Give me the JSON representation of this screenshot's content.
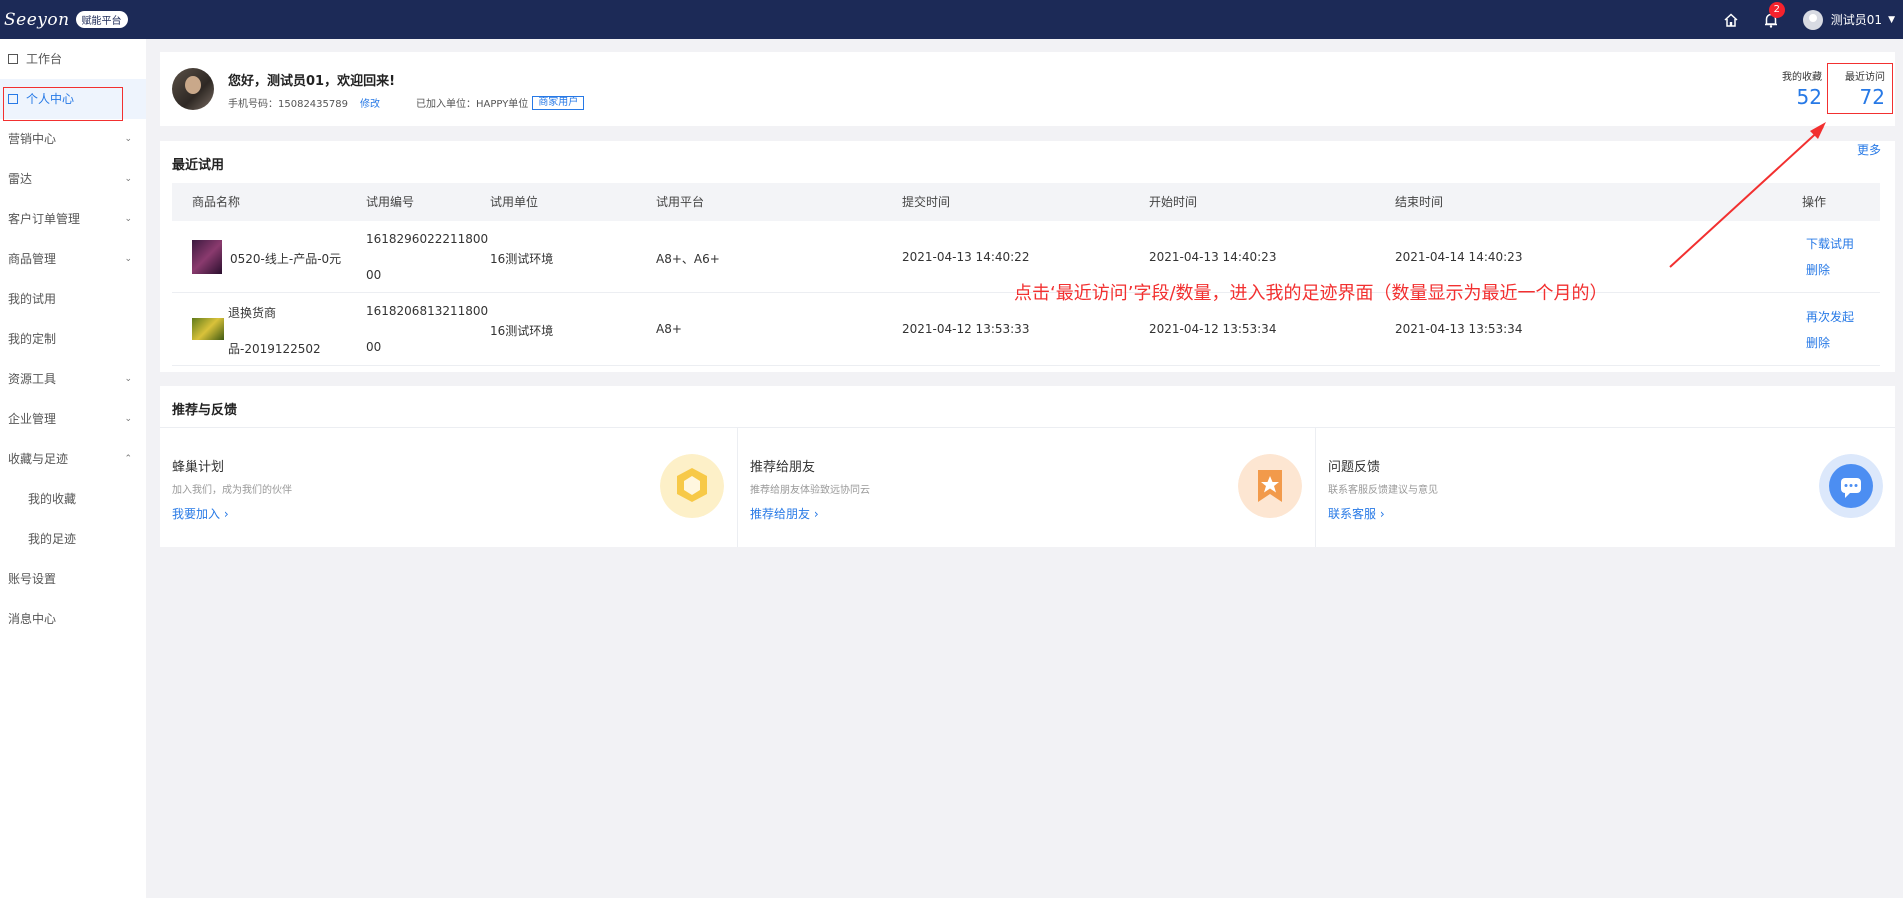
{
  "header": {
    "logo_text": "Seeyon",
    "platform_badge": "赋能平台",
    "notification_count": "2",
    "user_name": "测试员01",
    "icons": [
      "home-icon",
      "bell-icon",
      "avatar",
      "chevron-down-icon"
    ]
  },
  "sidebar": {
    "items": [
      {
        "label": "工作台"
      },
      {
        "label": "个人中心"
      },
      {
        "label": "营销中心"
      },
      {
        "label": "雷达"
      },
      {
        "label": "客户订单管理"
      },
      {
        "label": "商品管理"
      },
      {
        "label": "我的试用"
      },
      {
        "label": "我的定制"
      },
      {
        "label": "资源工具"
      },
      {
        "label": "企业管理"
      },
      {
        "label": "收藏与足迹"
      },
      {
        "label": "我的收藏"
      },
      {
        "label": "我的足迹"
      },
      {
        "label": "账号设置"
      },
      {
        "label": "消息中心"
      }
    ],
    "active_item": "个人中心"
  },
  "profile": {
    "greeting": "您好，测试员01，欢迎回来!",
    "phone_label": "手机号码：15082435789",
    "edit_link": "修改",
    "unit_label": "已加入单位：HAPPY单位",
    "user_type_tag": "商家用户",
    "favorites_label": "我的收藏",
    "favorites_count": "52",
    "recent_label": "最近访问",
    "recent_count": "72"
  },
  "recent_trials": {
    "title": "最近试用",
    "more_link": "更多",
    "columns": [
      "商品名称",
      "试用编号",
      "试用单位",
      "试用平台",
      "提交时间",
      "开始时间",
      "结束时间",
      "操作"
    ],
    "rows": [
      {
        "name_line1": "0520-线上-产品-0元",
        "name_line2": "",
        "id_line1": "1618296022211800",
        "id_line2": "00",
        "unit": "16测试环境",
        "platform": "A8+、A6+",
        "submit_time": "2021-04-13 14:40:22",
        "start_time": "2021-04-13 14:40:23",
        "end_time": "2021-04-14 14:40:23",
        "action1": "下载试用",
        "action2": "删除"
      },
      {
        "name_line1": "退换货商",
        "name_line2": "品-2019122502",
        "id_line1": "1618206813211800",
        "id_line2": "00",
        "unit": "16测试环境",
        "platform": "A8+",
        "submit_time": "2021-04-12 13:53:33",
        "start_time": "2021-04-12 13:53:34",
        "end_time": "2021-04-13 13:53:34",
        "action1": "再次发起",
        "action2": "删除"
      }
    ]
  },
  "recommend": {
    "title": "推荐与反馈",
    "cards": [
      {
        "title": "蜂巢计划",
        "desc": "加入我们，成为我们的伙伴",
        "link": "我要加入",
        "icon": "hive-icon",
        "color": "#f7c948"
      },
      {
        "title": "推荐给朋友",
        "desc": "推荐给朋友体验致远协同云",
        "link": "推荐给朋友",
        "icon": "ribbon-star-icon",
        "color": "#f29a4b"
      },
      {
        "title": "问题反馈",
        "desc": "联系客服反馈建议与意见",
        "link": "联系客服",
        "icon": "chat-bubble-icon",
        "color": "#4c8ef2"
      }
    ]
  },
  "annotation": {
    "text": "点击‘最近访问’字段/数量，进入我的足迹界面（数量显示为最近一个月的）",
    "color": "#f23030"
  },
  "colors": {
    "topbar": "#1c2a57",
    "accent": "#2779e6",
    "annotation": "#f23030"
  }
}
